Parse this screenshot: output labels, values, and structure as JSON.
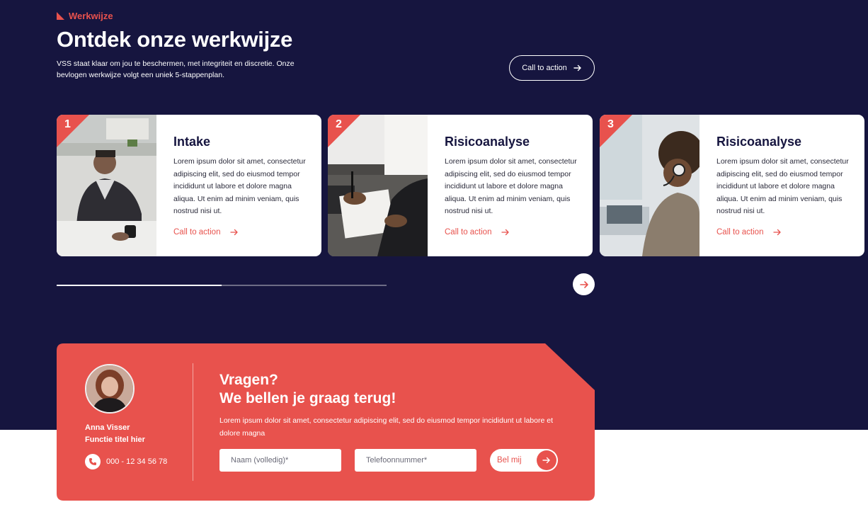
{
  "section": {
    "eyebrow": "Werkwijze",
    "title": "Ontdek onze werkwijze",
    "intro": "VSS staat klaar om jou te beschermen, met integriteit en discretie. Onze bevlogen werkwijze volgt een uniek 5-stappenplan.",
    "cta_label": "Call to action"
  },
  "cards": [
    {
      "step": "1",
      "title": "Intake",
      "text": "Lorem ipsum dolor sit amet, consectetur adipiscing elit, sed do eiusmod tempor incididunt ut labore et dolore magna aliqua. Ut enim ad minim veniam, quis nostrud nisi ut.",
      "link": "Call to action"
    },
    {
      "step": "2",
      "title": "Risicoanalyse",
      "text": "Lorem ipsum dolor sit amet, consectetur adipiscing elit, sed do eiusmod tempor incididunt ut labore et dolore magna aliqua. Ut enim ad minim veniam, quis nostrud nisi ut.",
      "link": "Call to action"
    },
    {
      "step": "3",
      "title": "Risicoanalyse",
      "text": "Lorem ipsum dolor sit amet, consectetur adipiscing elit, sed do eiusmod tempor incididunt ut labore et dolore magna aliqua. Ut enim ad minim veniam, quis nostrud nisi ut.",
      "link": "Call to action"
    }
  ],
  "slider": {
    "progress": 0.5
  },
  "contact": {
    "name": "Anna Visser",
    "role": "Functie titel hier",
    "phone": "000 - 12 34 56 78",
    "title_line1": "Vragen?",
    "title_line2": "We bellen je graag terug!",
    "text": "Lorem ipsum dolor sit amet, consectetur adipiscing elit, sed do eiusmod tempor incididunt ut labore et dolore magna",
    "name_placeholder": "Naam (volledig)*",
    "phone_placeholder": "Telefoonnummer*",
    "submit_label": "Bel mij"
  },
  "colors": {
    "navy": "#16153f",
    "accent": "#e8524d",
    "white": "#ffffff"
  }
}
